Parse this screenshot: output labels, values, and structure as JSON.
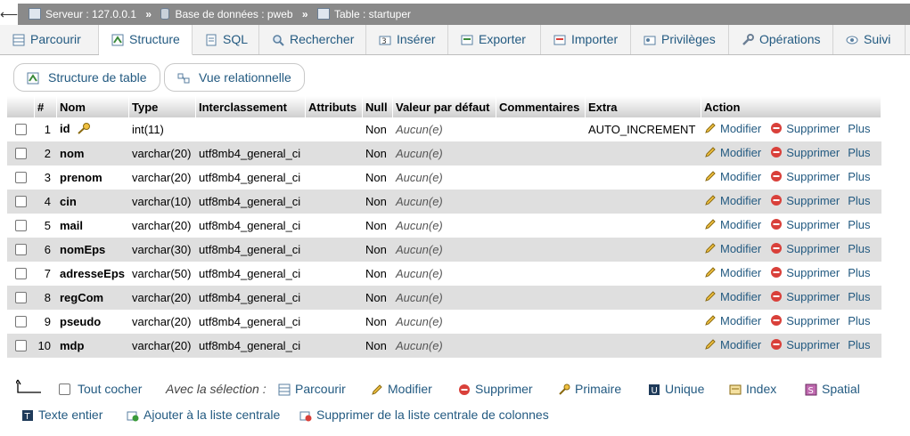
{
  "breadcrumb": {
    "server": "Serveur : 127.0.0.1",
    "database": "Base de données : pweb",
    "table": "Table : startuper",
    "separator": "»"
  },
  "tabs": [
    "Parcourir",
    "Structure",
    "SQL",
    "Rechercher",
    "Insérer",
    "Exporter",
    "Importer",
    "Privilèges",
    "Opérations",
    "Suivi"
  ],
  "active_tab": "Structure",
  "subtabs": [
    "Structure de table",
    "Vue relationnelle"
  ],
  "columns": [
    "#",
    "Nom",
    "Type",
    "Interclassement",
    "Attributs",
    "Null",
    "Valeur par défaut",
    "Commentaires",
    "Extra",
    "Action"
  ],
  "rows": [
    {
      "num": "1",
      "name": "id",
      "type": "int(11)",
      "collation": "",
      "attributes": "",
      "null": "Non",
      "default": "Aucun(e)",
      "comments": "",
      "extra": "AUTO_INCREMENT",
      "primary": true
    },
    {
      "num": "2",
      "name": "nom",
      "type": "varchar(20)",
      "collation": "utf8mb4_general_ci",
      "attributes": "",
      "null": "Non",
      "default": "Aucun(e)",
      "comments": "",
      "extra": ""
    },
    {
      "num": "3",
      "name": "prenom",
      "type": "varchar(20)",
      "collation": "utf8mb4_general_ci",
      "attributes": "",
      "null": "Non",
      "default": "Aucun(e)",
      "comments": "",
      "extra": ""
    },
    {
      "num": "4",
      "name": "cin",
      "type": "varchar(10)",
      "collation": "utf8mb4_general_ci",
      "attributes": "",
      "null": "Non",
      "default": "Aucun(e)",
      "comments": "",
      "extra": ""
    },
    {
      "num": "5",
      "name": "mail",
      "type": "varchar(20)",
      "collation": "utf8mb4_general_ci",
      "attributes": "",
      "null": "Non",
      "default": "Aucun(e)",
      "comments": "",
      "extra": ""
    },
    {
      "num": "6",
      "name": "nomEps",
      "type": "varchar(30)",
      "collation": "utf8mb4_general_ci",
      "attributes": "",
      "null": "Non",
      "default": "Aucun(e)",
      "comments": "",
      "extra": ""
    },
    {
      "num": "7",
      "name": "adresseEps",
      "type": "varchar(50)",
      "collation": "utf8mb4_general_ci",
      "attributes": "",
      "null": "Non",
      "default": "Aucun(e)",
      "comments": "",
      "extra": ""
    },
    {
      "num": "8",
      "name": "regCom",
      "type": "varchar(20)",
      "collation": "utf8mb4_general_ci",
      "attributes": "",
      "null": "Non",
      "default": "Aucun(e)",
      "comments": "",
      "extra": ""
    },
    {
      "num": "9",
      "name": "pseudo",
      "type": "varchar(20)",
      "collation": "utf8mb4_general_ci",
      "attributes": "",
      "null": "Non",
      "default": "Aucun(e)",
      "comments": "",
      "extra": ""
    },
    {
      "num": "10",
      "name": "mdp",
      "type": "varchar(20)",
      "collation": "utf8mb4_general_ci",
      "attributes": "",
      "null": "Non",
      "default": "Aucun(e)",
      "comments": "",
      "extra": ""
    }
  ],
  "row_actions": {
    "modify": "Modifier",
    "delete": "Supprimer",
    "more": "Plus"
  },
  "bulk": {
    "check_all": "Tout cocher",
    "with_selection": "Avec la sélection :",
    "actions": [
      "Parcourir",
      "Modifier",
      "Supprimer",
      "Primaire",
      "Unique",
      "Index",
      "Spatial"
    ],
    "actions2": [
      "Texte entier",
      "Ajouter à la liste centrale",
      "Supprimer de la liste centrale de colonnes"
    ]
  },
  "colors": {
    "link": "#235a81",
    "topbar": "#8a8a8a",
    "row_alt": "#dfdfdf",
    "delete_red": "#d9403a"
  }
}
